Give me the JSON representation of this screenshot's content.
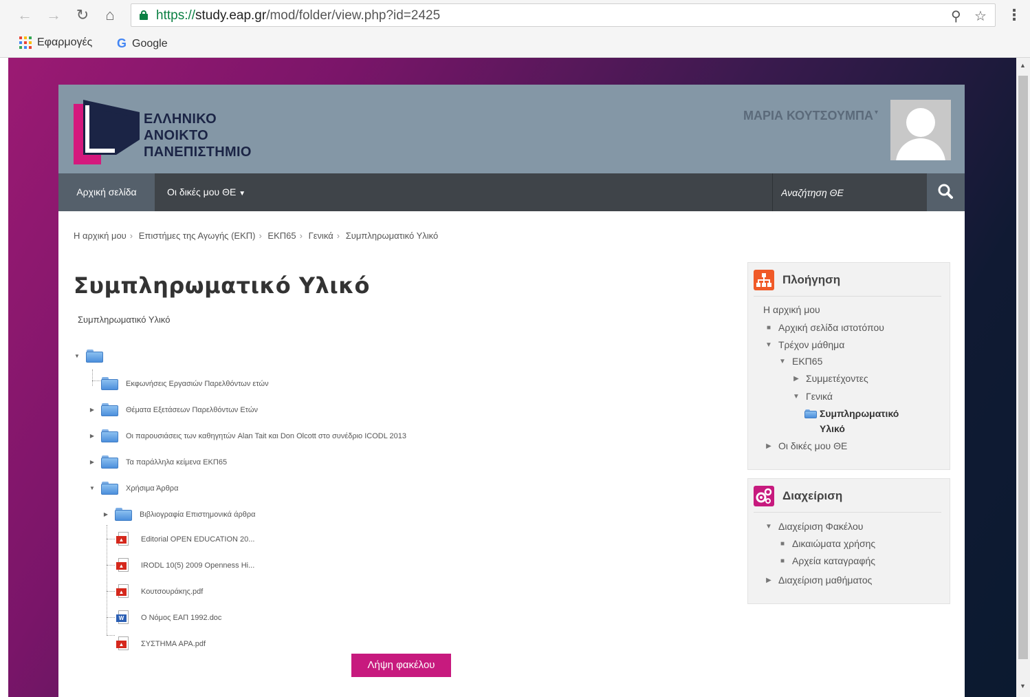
{
  "browser": {
    "url_scheme": "https://",
    "url_host": "study.eap.gr",
    "url_path": "/mod/folder/view.php?id=2425",
    "bookmarks": [
      {
        "label": "Εφαρμογές"
      },
      {
        "label": "Google"
      }
    ]
  },
  "header": {
    "logo_lines": [
      "ΕΛΛΗΝΙΚΟ",
      "ΑΝΟΙΚΤΟ",
      "ΠΑΝΕΠΙΣΤΗΜΙΟ"
    ],
    "user_name": "ΜΑΡΙΑ ΚΟΥΤΣΟΥΜΠΑ"
  },
  "navbar": {
    "home": "Αρχική σελίδα",
    "my_courses": "Οι δικές μου ΘΕ",
    "search_placeholder": "Αναζήτηση ΘΕ"
  },
  "breadcrumb": [
    "Η αρχική μου",
    "Επιστήμες της Αγωγής (ΕΚΠ)",
    "ΕΚΠ65",
    "Γενικά",
    "Συμπληρωματικό Υλικό"
  ],
  "main": {
    "title": "Συμπληρωματικό Υλικό",
    "intro": "Συμπληρωματικό Υλικό",
    "tree": [
      {
        "label": "Εκφωνήσεις Εργασιών Παρελθόντων ετών"
      },
      {
        "label": "Θέματα Εξετάσεων Παρελθόντων Ετών"
      },
      {
        "label": "Οι παρουσιάσεις των καθηγητών Alan Tait και Don Olcott στο συνέδριο ICODL 2013"
      },
      {
        "label": "Τα παράλληλα κείμενα ΕΚΠ65"
      },
      {
        "label": "Χρήσιμα Άρθρα"
      },
      {
        "label": "Βιβλιογραφία Επιστημονικά άρθρα"
      },
      {
        "label": "Editorial OPEN EDUCATION 20..."
      },
      {
        "label": "IRODL 10(5) 2009 Openness Hi..."
      },
      {
        "label": "Κουτσουράκης.pdf"
      },
      {
        "label": "Ο Νόμος ΕΑΠ 1992.doc"
      },
      {
        "label": "ΣΥΣΤΗΜΑ APA.pdf"
      }
    ],
    "download_label": "Λήψη φακέλου"
  },
  "navigation_block": {
    "title": "Πλοήγηση",
    "items": [
      {
        "label": "Η αρχική μου"
      },
      {
        "label": "Αρχική σελίδα ιστοτόπου"
      },
      {
        "label": "Τρέχον μάθημα"
      },
      {
        "label": "ΕΚΠ65"
      },
      {
        "label": "Συμμετέχοντες"
      },
      {
        "label": "Γενικά"
      },
      {
        "label": "Συμπληρωματικό"
      },
      {
        "label": "Υλικό"
      },
      {
        "label": "Οι δικές μου ΘΕ"
      }
    ]
  },
  "admin_block": {
    "title": "Διαχείριση",
    "items": [
      {
        "label": "Διαχείριση Φακέλου"
      },
      {
        "label": "Δικαιώματα χρήσης"
      },
      {
        "label": "Αρχεία καταγραφής"
      },
      {
        "label": "Διαχείριση μαθήματος"
      }
    ]
  },
  "colors": {
    "accent": "#c71a7e",
    "header": "#8497a6",
    "navbar": "#3f4449",
    "nav_icon": "#f05a28",
    "admin_icon": "#c71a7e"
  }
}
